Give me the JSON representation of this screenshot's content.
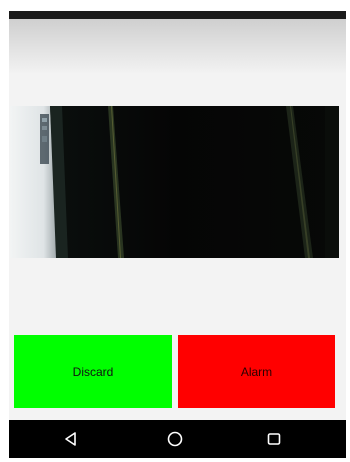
{
  "buttons": {
    "discard_label": "Discard",
    "alarm_label": "Alarm"
  },
  "nav_bar": {
    "back_icon": "back-triangle-icon",
    "home_icon": "home-circle-icon",
    "recents_icon": "recents-square-icon"
  },
  "colors": {
    "discard": "#00ff00",
    "alarm": "#ff0000",
    "status_bar": "#1a1a1a",
    "nav_bar": "#000000"
  }
}
